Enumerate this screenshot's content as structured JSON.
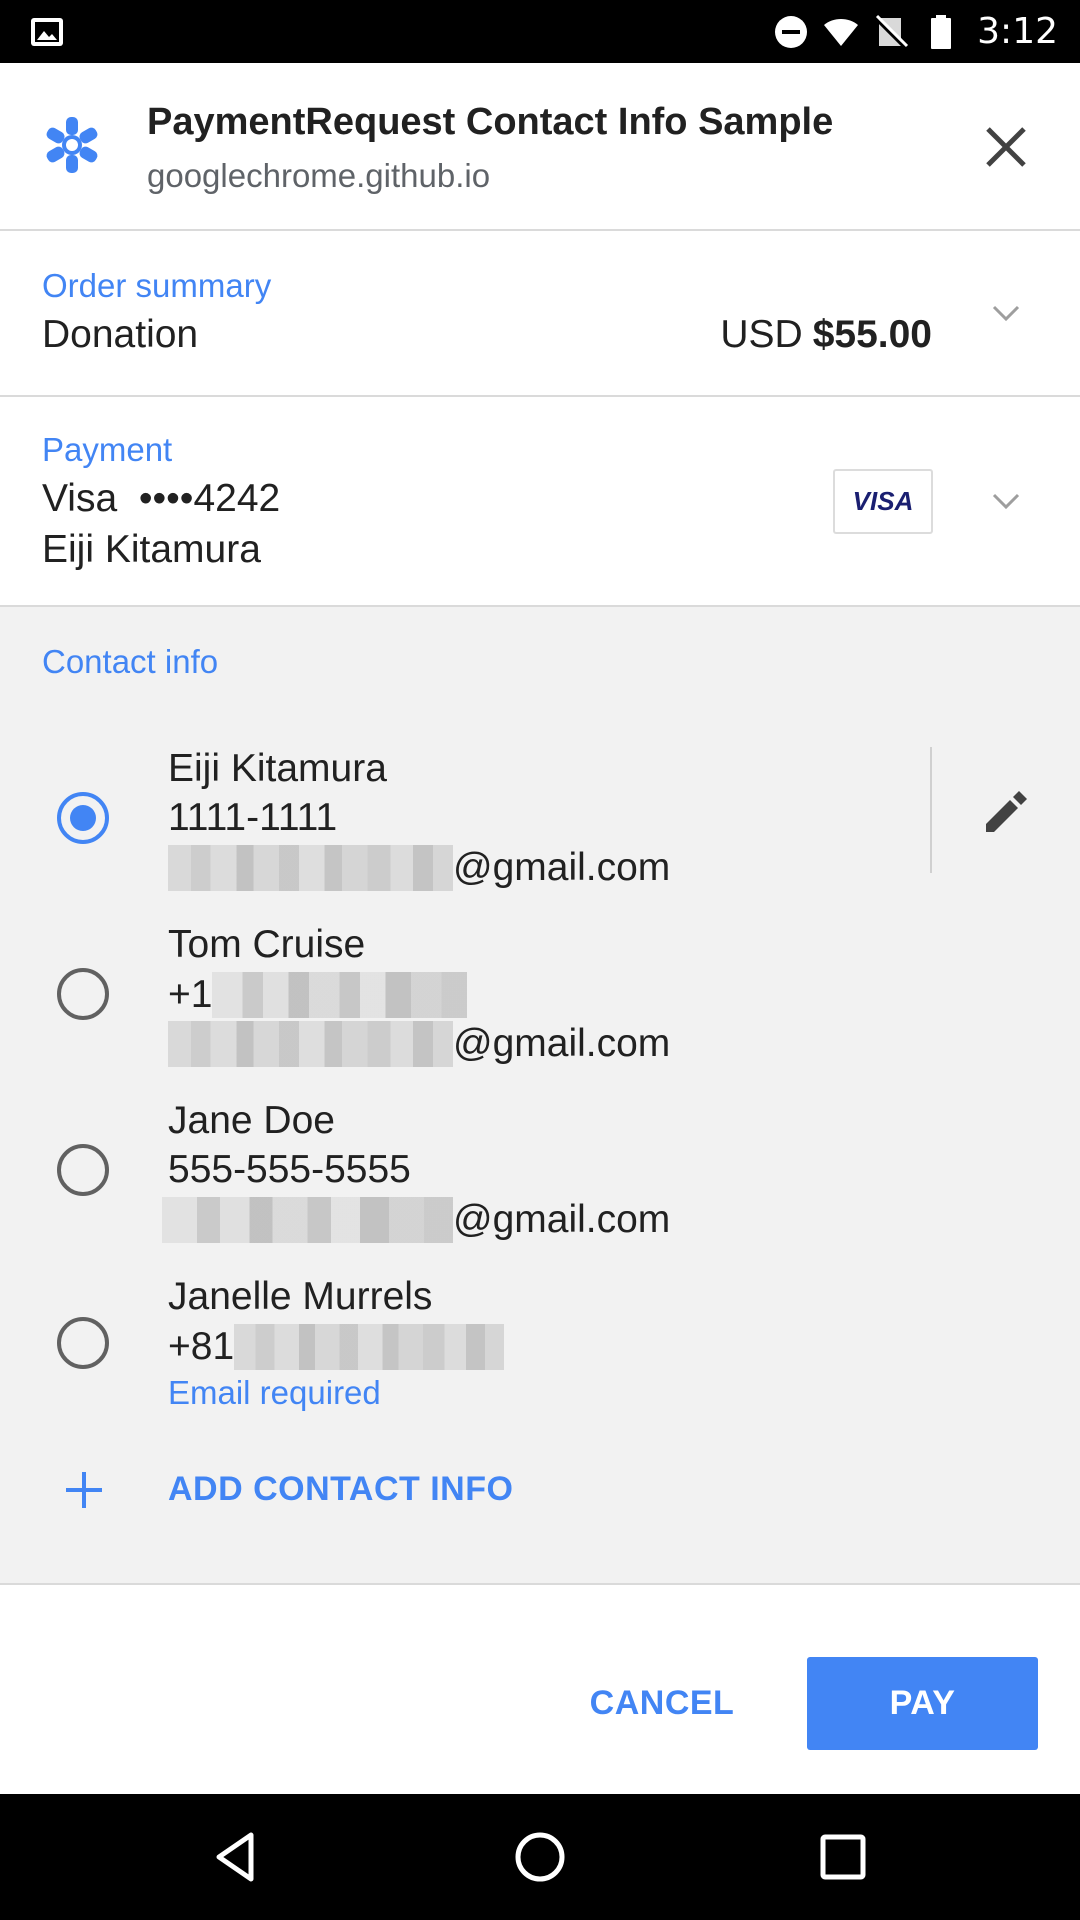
{
  "status_bar": {
    "time": "3:12",
    "icons": [
      "image-notification-icon",
      "do-not-disturb-icon",
      "wifi-icon",
      "no-signal-icon",
      "battery-icon"
    ]
  },
  "header": {
    "title": "PaymentRequest Contact Info Sample",
    "origin": "googlechrome.github.io",
    "site_icon": "asterisk-badge-icon",
    "close_icon": "close-icon"
  },
  "order_summary": {
    "label": "Order summary",
    "item": "Donation",
    "currency": "USD",
    "amount": "$55.00"
  },
  "payment": {
    "label": "Payment",
    "card": "Visa  ••••4242",
    "cardholder": "Eiji Kitamura",
    "card_brand": "VISA"
  },
  "contact_info": {
    "label": "Contact info",
    "options": [
      {
        "name": "Eiji Kitamura",
        "phone": "1111-1111",
        "email_suffix": "@gmail.com",
        "selected": true
      },
      {
        "name": "Tom Cruise",
        "phone_prefix": "+1",
        "email_suffix": "@gmail.com",
        "selected": false
      },
      {
        "name": "Jane Doe",
        "phone": "555-555-5555",
        "email_suffix": "@gmail.com",
        "selected": false
      },
      {
        "name": "Janelle Murrels",
        "phone_prefix": "+81",
        "warning": "Email required",
        "selected": false
      }
    ],
    "add_label": "ADD CONTACT INFO"
  },
  "footer": {
    "cancel_label": "CANCEL",
    "pay_label": "PAY"
  },
  "colors": {
    "accent": "#4285f4",
    "section_bg": "#f2f2f2",
    "text": "#212121",
    "secondary_text": "#5f6368"
  }
}
